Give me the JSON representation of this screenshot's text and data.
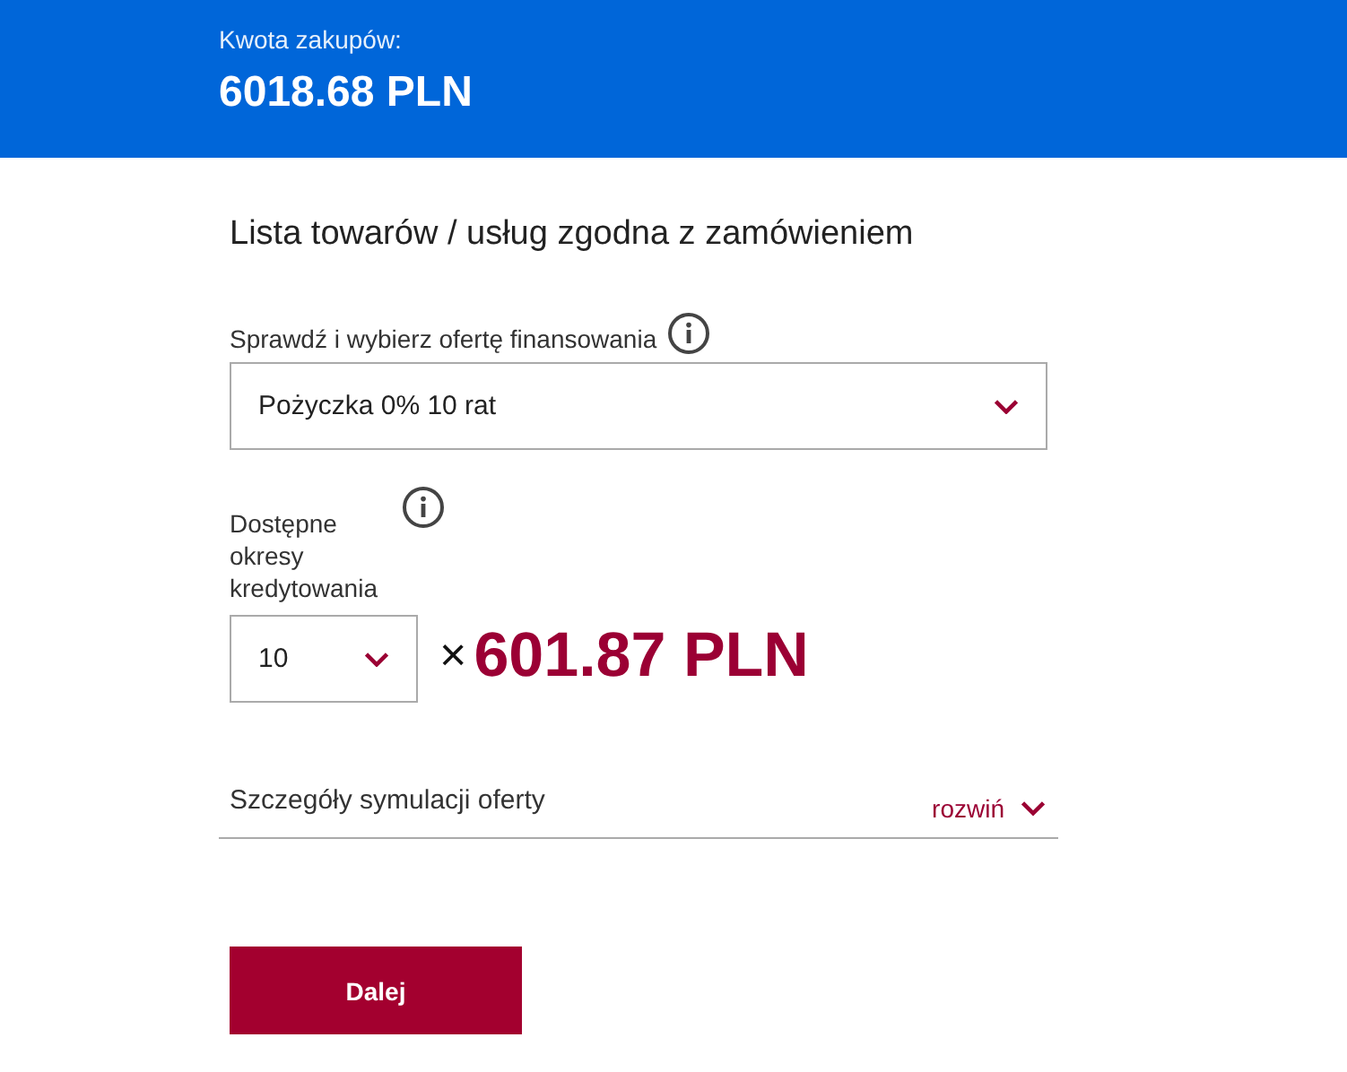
{
  "header": {
    "label": "Kwota zakupów:",
    "amount": "6018.68 PLN"
  },
  "title": "Lista towarów / usług zgodna z zamówieniem",
  "offer": {
    "label": "Sprawdź i wybierz ofertę finansowania",
    "value": "Pożyczka 0% 10 rat"
  },
  "period": {
    "label": "Dostępne okresy kredytowania",
    "value": "10",
    "times": "×",
    "installment": "601.87 PLN"
  },
  "details": {
    "label": "Szczegóły symulacji oferty",
    "toggle": "rozwiń",
    "expanded": false
  },
  "buttons": [
    "Dalej"
  ]
}
